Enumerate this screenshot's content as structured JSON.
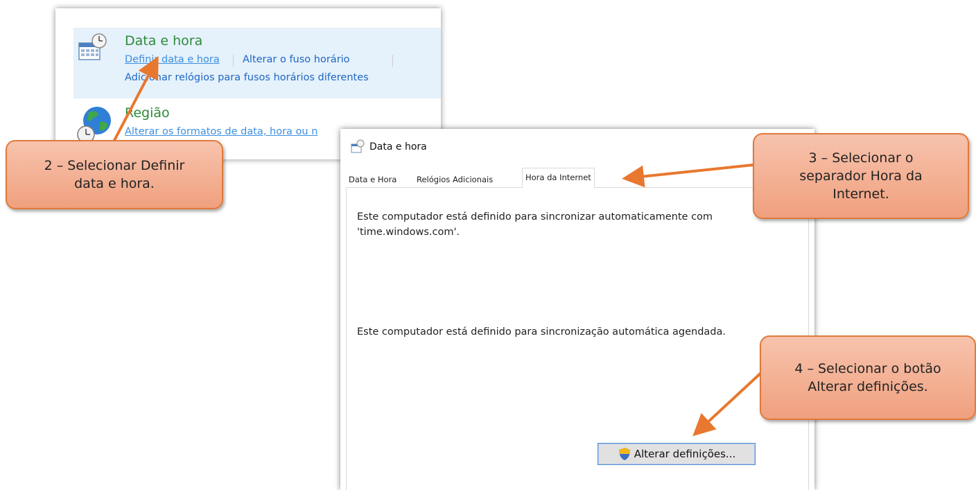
{
  "control_panel": {
    "date_time": {
      "title": "Data e hora",
      "links": [
        "Definir data e hora",
        "Alterar o fuso horário"
      ],
      "link_line2": "Adicionar relógios para fusos horários diferentes"
    },
    "region": {
      "title": "Região",
      "link": "Alterar os formatos de data, hora ou n"
    }
  },
  "dialog": {
    "title": "Data e hora",
    "tabs": [
      "Data e Hora",
      "Relógios Adicionais",
      "Hora da Internet"
    ],
    "active_tab": "Hora da Internet",
    "text1": "Este computador está definido para sincronizar automaticamente com 'time.windows.com'.",
    "text2": "Este computador está definido para sincronização automática agendada.",
    "button_label": "Alterar definições..."
  },
  "callouts": {
    "step2": "2 – Selecionar Definir\ndata e hora.",
    "step3": "3 – Selecionar o\nseparador Hora da\nInternet.",
    "step4": "4 – Selecionar o botão\nAlterar definições."
  },
  "colors": {
    "callout_fill": "#f4b08f",
    "callout_border": "#e07a3a",
    "arrow": "#e8782f",
    "link": "#1e66c4",
    "title_green": "#2e8a3a",
    "highlight": "#e5f1fb"
  }
}
